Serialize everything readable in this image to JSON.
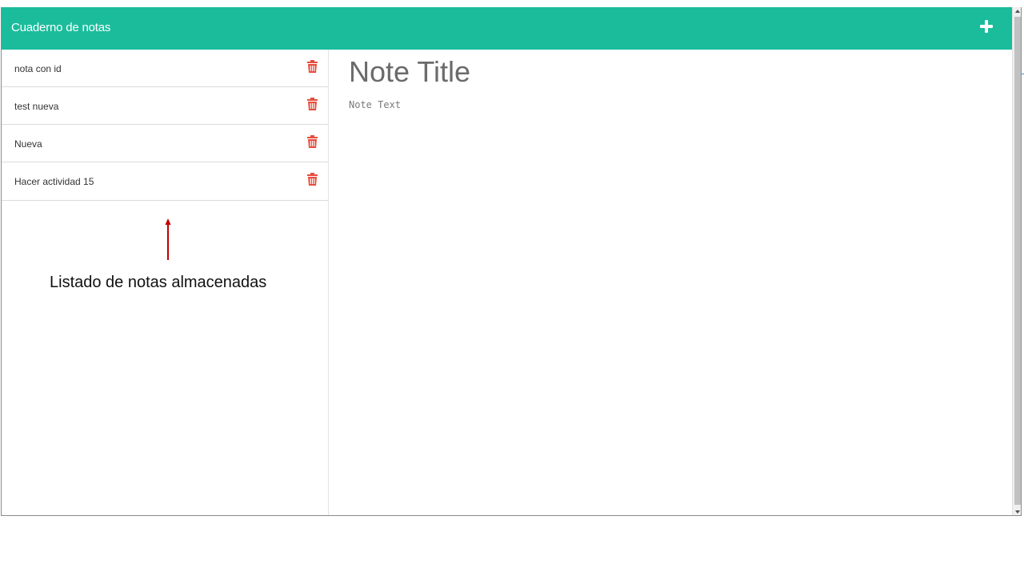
{
  "header": {
    "brand": "Cuaderno de notas",
    "add_icon": "plus-icon"
  },
  "sidebar": {
    "items": [
      {
        "label": "nota con id",
        "icon": "trash-icon"
      },
      {
        "label": "test nueva",
        "icon": "trash-icon"
      },
      {
        "label": "Nueva",
        "icon": "trash-icon"
      },
      {
        "label": "Hacer actividad 15",
        "icon": "trash-icon"
      }
    ]
  },
  "annotation": {
    "text": "Listado de notas almacenadas",
    "arrow_icon": "arrow-up-icon"
  },
  "editor": {
    "title_placeholder": "Note Title",
    "text_placeholder": "Note Text"
  },
  "colors": {
    "accent": "#1abc9c",
    "trash": "#e74c3c",
    "annotation_arrow": "#c00000"
  }
}
